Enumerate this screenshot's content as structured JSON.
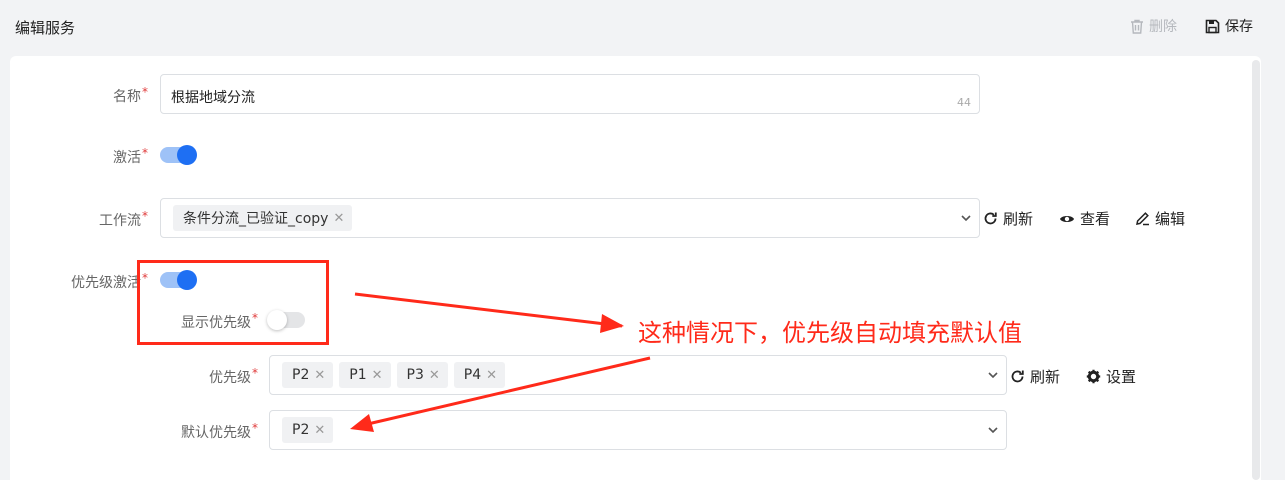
{
  "header": {
    "title": "编辑服务",
    "delete_label": "删除",
    "save_label": "保存"
  },
  "form": {
    "name": {
      "label": "名称",
      "value": "根据地域分流",
      "counter": "44"
    },
    "active": {
      "label": "激活",
      "on": true
    },
    "workflow": {
      "label": "工作流",
      "tags": [
        "条件分流_已验证_copy"
      ],
      "actions": [
        "刷新",
        "查看",
        "编辑"
      ]
    },
    "priority_active": {
      "label": "优先级激活",
      "on": true
    },
    "show_priority": {
      "label": "显示优先级",
      "on": false
    },
    "priority": {
      "label": "优先级",
      "tags": [
        "P2",
        "P1",
        "P3",
        "P4"
      ],
      "actions": [
        "刷新",
        "设置"
      ]
    },
    "default_priority": {
      "label": "默认优先级",
      "tags": [
        "P2"
      ]
    }
  },
  "annotation": {
    "text": "这种情况下，优先级自动填充默认值",
    "color": "#ff2a1a"
  },
  "colors": {
    "accent": "#1e6ff3",
    "required": "#e03b3b"
  }
}
